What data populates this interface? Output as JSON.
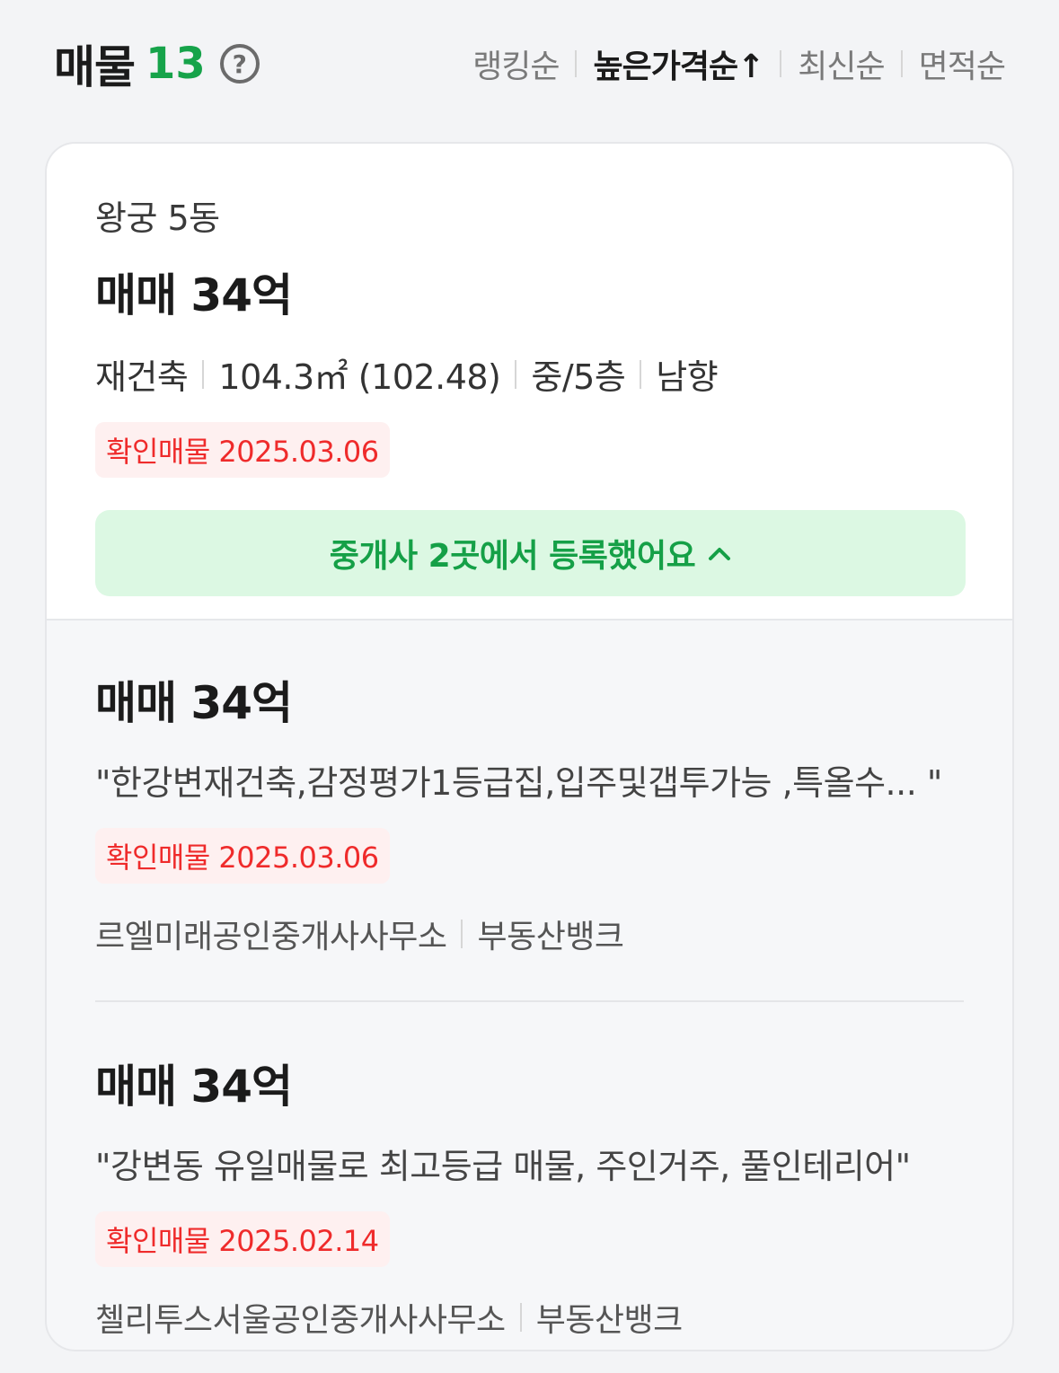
{
  "header": {
    "title": "매물",
    "count": "13",
    "help_icon": "question-circle-icon",
    "sort_options": [
      {
        "label": "랭킹순",
        "active": false
      },
      {
        "label": "높은가격순↑",
        "active": true
      },
      {
        "label": "최신순",
        "active": false
      },
      {
        "label": "면적순",
        "active": false
      }
    ]
  },
  "main_listing": {
    "building": "왕궁 5동",
    "price": "매매 34억",
    "specs": [
      "재건축",
      "104.3㎡ (102.48)",
      "중/5층",
      "남향"
    ],
    "verified": "확인매물 2025.03.06",
    "agents_button": "중개사 2곳에서 등록했어요",
    "agents_button_icon": "chevron-up-icon"
  },
  "listings": [
    {
      "price": "매매 34억",
      "description": "\"한강변재건축,감정평가1등급집,입주및갭투가능 ,특올수...   \"",
      "verified": "확인매물 2025.03.06",
      "agency": "르엘미래공인중개사사무소",
      "source": "부동산뱅크"
    },
    {
      "price": "매매 34억",
      "description": "\"강변동 유일매물로 최고등급 매물, 주인거주, 풀인테리어\"",
      "verified": "확인매물 2025.02.14",
      "agency": "첼리투스서울공인중개사사무소",
      "source": "부동산뱅크"
    }
  ],
  "colors": {
    "accent_green": "#16a34a",
    "verified_red": "#ef2b2b",
    "button_bg": "#dcf8e3"
  }
}
